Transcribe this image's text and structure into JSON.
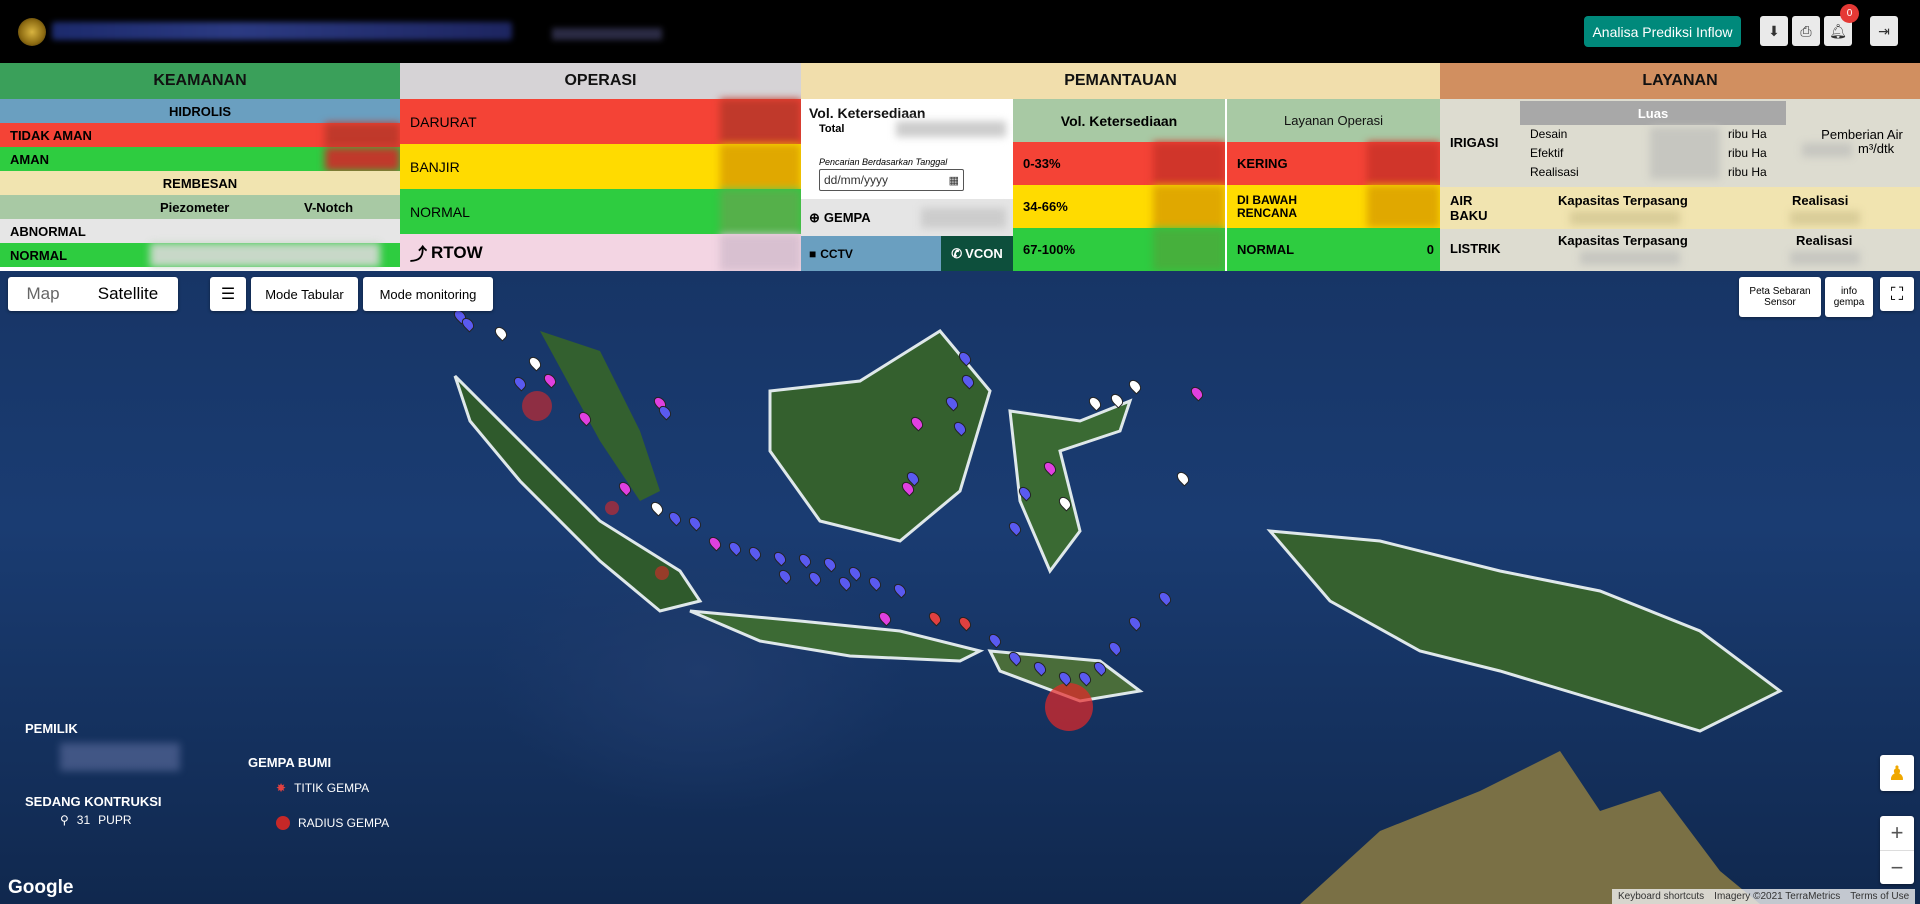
{
  "topbar": {
    "inflow_label": "Analisa Prediksi Inflow",
    "notification_count": "0"
  },
  "keamanan": {
    "title": "KEAMANAN",
    "hidrolis": "HIDROLIS",
    "tidak_aman": "TIDAK AMAN",
    "aman": "AMAN",
    "rembesan": "REMBESAN",
    "piezometer": "Piezometer",
    "vnotch": "V-Notch",
    "abnormal": "ABNORMAL",
    "normal": "NORMAL"
  },
  "operasi": {
    "title": "OPERASI",
    "darurat": "DARURAT",
    "banjir": "BANJIR",
    "normal": "NORMAL",
    "rtow": "RTOW"
  },
  "pemantauan": {
    "title": "PEMANTAUAN",
    "vol_title": "Vol. Ketersediaan",
    "total": "Total",
    "search_label": "Pencarian Berdasarkan Tanggal",
    "date_placeholder": "dd/mm/yyyy",
    "gempa": "GEMPA",
    "cctv": "CCTV",
    "vcon": "VCON",
    "vol_header": "Vol. Ketersediaan",
    "range1": "0-33%",
    "range2": "34-66%",
    "range3": "67-100%",
    "layanan_header": "Layanan Operasi",
    "kering": "KERING",
    "di_bawah": "DI BAWAH RENCANA",
    "normal": "NORMAL",
    "normal_value": "0"
  },
  "layanan": {
    "title": "LAYANAN",
    "irigasi": "IRIGASI",
    "luas": "Luas",
    "desain": "Desain",
    "efektif": "Efektif",
    "realisasi": "Realisasi",
    "unit": "ribu  Ha",
    "pemberian_air": "Pemberian Air",
    "pemberian_unit": "m³/dtk",
    "air_baku": "AIR BAKU",
    "kapasitas": "Kapasitas Terpasang",
    "realisasi2": "Realisasi",
    "listrik": "LISTRIK"
  },
  "map": {
    "tab_map": "Map",
    "tab_satellite": "Satellite",
    "menu_icon": "hamburger-icon",
    "mode_tabular": "Mode Tabular",
    "mode_monitoring": "Mode monitoring",
    "peta_sebaran": "Peta Sebaran Sensor",
    "info_gempa": "info gempa",
    "legend_pemilik": "PEMILIK",
    "legend_sedang": "SEDANG KONTRUKSI",
    "legend_sedang_count": "31",
    "legend_sedang_owner": "PUPR",
    "legend_gempa": "GEMPA BUMI",
    "legend_titik": "TITIK GEMPA",
    "legend_radius": "RADIUS GEMPA",
    "google": "Google",
    "attr_shortcuts": "Keyboard shortcuts",
    "attr_imagery": "Imagery ©2021 TerraMetrics",
    "attr_terms": "Terms of Use"
  }
}
